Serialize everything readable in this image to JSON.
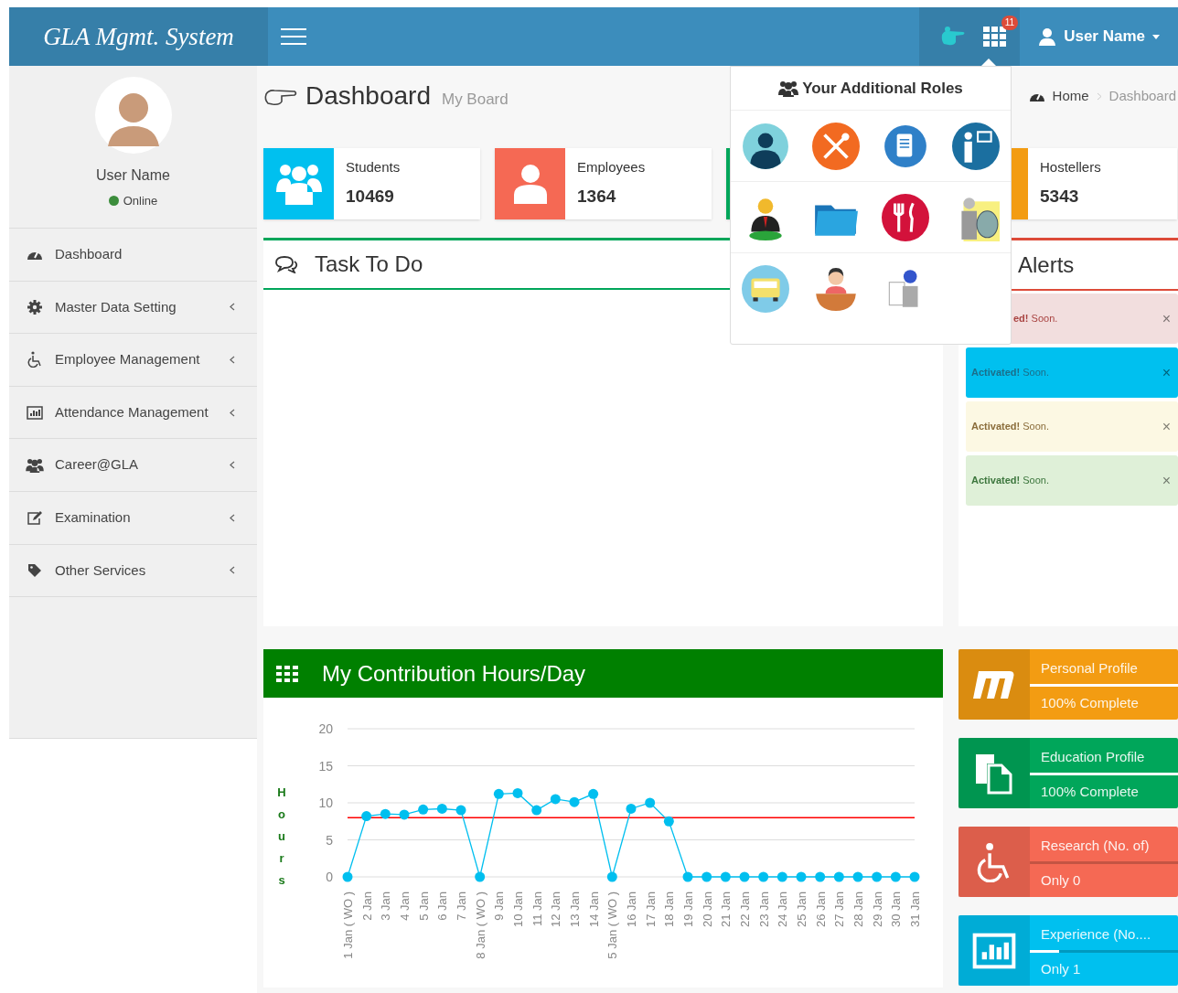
{
  "header": {
    "logo": "GLA Mgmt. System",
    "notification_count": "11",
    "user_name": "User Name"
  },
  "sidebar": {
    "user": {
      "name": "User Name",
      "status": "Online"
    },
    "items": [
      {
        "label": "Dashboard",
        "has_submenu": false
      },
      {
        "label": "Master Data Setting",
        "has_submenu": true
      },
      {
        "label": "Employee Management",
        "has_submenu": true
      },
      {
        "label": "Attendance Management",
        "has_submenu": true
      },
      {
        "label": "Career@GLA",
        "has_submenu": true
      },
      {
        "label": "Examination",
        "has_submenu": true
      },
      {
        "label": "Other Services",
        "has_submenu": true
      }
    ]
  },
  "page_header": {
    "title": "Dashboard",
    "subtitle": "My Board",
    "breadcrumb": [
      "Home",
      "Dashboard"
    ]
  },
  "info_boxes": [
    {
      "label": "Students",
      "value": "10469",
      "color": "#00c0ef"
    },
    {
      "label": "Employees",
      "value": "1364",
      "color": "#f56954"
    },
    {
      "color": "#00a65a"
    },
    {
      "label": "Hostellers",
      "value": "5343",
      "color": "#f39c12"
    }
  ],
  "task_box": {
    "title": "Task To Do"
  },
  "alerts": {
    "title": "Alerts",
    "items": [
      {
        "kind": "danger",
        "text": "**ed!** Soon.",
        "close": "×"
      },
      {
        "kind": "info",
        "text": "**Activated!** Soon.",
        "close": "×"
      },
      {
        "kind": "warning",
        "text": "**Activated!** Soon.",
        "close": "×"
      },
      {
        "kind": "success",
        "text": "**Activated!** Soon.",
        "close": "×"
      }
    ]
  },
  "roles_dropdown": {
    "title": "Your Additional Roles",
    "roles": [
      {
        "kind": "person"
      },
      {
        "kind": "cutlery"
      },
      {
        "kind": "document"
      },
      {
        "kind": "teacher"
      },
      {
        "kind": "manager"
      },
      {
        "kind": "folder"
      },
      {
        "kind": "restaurant"
      },
      {
        "kind": "scientist"
      },
      {
        "kind": "bus"
      },
      {
        "kind": "receptionist"
      },
      {
        "kind": "technician"
      }
    ]
  },
  "contribution": {
    "title": "My Contribution Hours/Day",
    "chart_data": {
      "type": "line",
      "ylabel": "Hours",
      "categories": [
        "1 Jan ( WO )",
        "2 Jan",
        "3 Jan",
        "4 Jan",
        "5 Jan",
        "6 Jan",
        "7 Jan",
        "8 Jan ( WO )",
        "9 Jan",
        "10 Jan",
        "11 Jan",
        "12 Jan",
        "13 Jan",
        "14 Jan",
        "5 Jan ( WO )",
        "16 Jan",
        "17 Jan",
        "18 Jan",
        "19 Jan",
        "20 Jan",
        "21 Jan",
        "22 Jan",
        "23 Jan",
        "24 Jan",
        "25 Jan",
        "26 Jan",
        "27 Jan",
        "28 Jan",
        "29 Jan",
        "30 Jan",
        "31 Jan"
      ],
      "values": [
        0,
        8.2,
        8.5,
        8.4,
        9.1,
        9.2,
        9.0,
        0,
        11.2,
        11.3,
        9.0,
        10.5,
        10.1,
        11.2,
        0,
        9.2,
        10.0,
        7.5,
        0,
        0,
        0,
        0,
        0,
        0,
        0,
        0,
        0,
        0,
        0,
        0,
        0
      ],
      "ylim": [
        0,
        20
      ],
      "yticks": [
        0,
        5,
        10,
        15,
        20
      ],
      "grid": true,
      "marker": true,
      "ref_lines": [
        {
          "axis": "y",
          "value": 8,
          "color": "#ff0000"
        }
      ]
    }
  },
  "profile_boxes": [
    {
      "title": "Personal Profile",
      "detail": "100% Complete",
      "level": 1,
      "color": "#f39c12"
    },
    {
      "title": "Education Profile",
      "detail": "100% Complete",
      "level": 1,
      "color": "#00a65a"
    },
    {
      "title": "Research (No. of)",
      "detail": "Only 0",
      "level": 0,
      "color": "#f56954"
    },
    {
      "title": "Experience (No....",
      "detail": "Only 1",
      "level": 0.2,
      "color": "#00c0ef"
    }
  ]
}
